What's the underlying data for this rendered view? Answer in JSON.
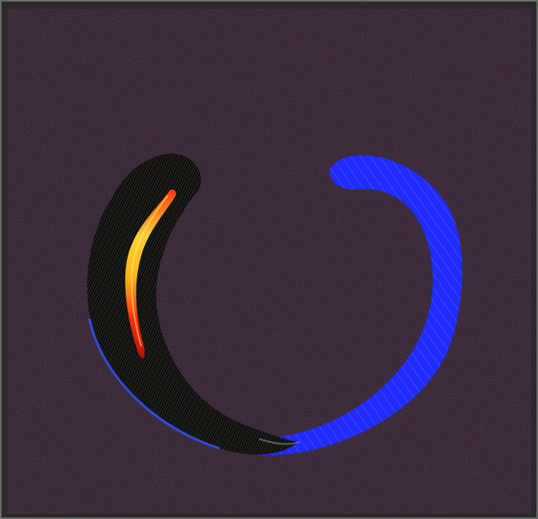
{
  "image": {
    "subject": "",
    "colors": {
      "frame": "#6b6b6b",
      "noise_bg": "#2a1f22",
      "blue_arc": "#1f2bff",
      "red_core": "#ff2a12",
      "yellow_core": "#ffd23a",
      "dark_body": "#0d0b0c"
    }
  }
}
